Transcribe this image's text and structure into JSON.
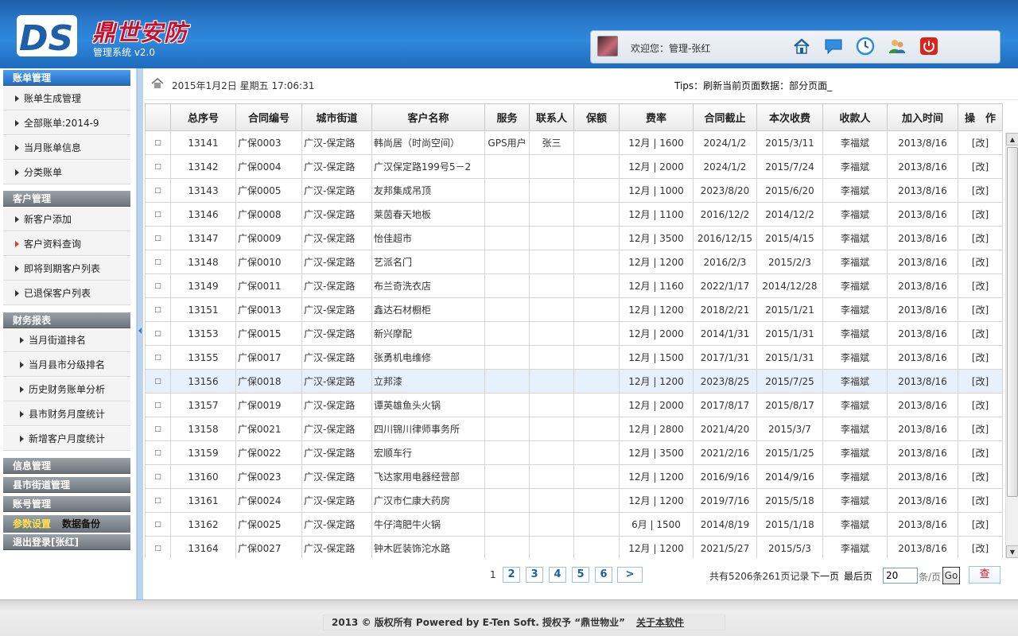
{
  "header": {
    "logo_text": "DS",
    "brand": "鼎世安防",
    "subtitle": "管理系统 v2.0",
    "welcome": "欢迎您：管理-张红",
    "icons": [
      "home-icon",
      "message-icon",
      "clock-icon",
      "users-icon",
      "power-icon"
    ]
  },
  "sidebar": {
    "groups": [
      {
        "title": "账单管理",
        "items": [
          "账单生成管理",
          "全部账单:2014-9",
          "当月账单信息",
          "分类账单"
        ]
      },
      {
        "title": "客户管理",
        "items": [
          "新客户添加",
          "客户资料查询",
          "即将到期客户列表",
          "已退保客户列表"
        ]
      },
      {
        "title": "财务报表",
        "items": [
          "当月街道排名",
          "当月县市分级排名",
          "历史财务账单分析",
          "县市财务月度统计",
          "新增客户月度统计"
        ]
      }
    ],
    "info_mgmt": "信息管理",
    "county_mgmt": "县市街道管理",
    "account_mgmt": "账号管理",
    "params": "参数设置",
    "backup": "数据备份",
    "logout": "退出登录[张红]"
  },
  "topbar": {
    "date": "2015年1月2日  星期五  17:06:31",
    "tips": "Tips：刷新当前页面数据：部分页面_"
  },
  "table": {
    "headers": [
      "",
      "总序号",
      "合同编号",
      "城市街道",
      "客户名称",
      "服务",
      "联系人",
      "保额",
      "费率",
      "合同截止",
      "本次收费",
      "收款人",
      "加入时间",
      "操　作"
    ],
    "rows": [
      [
        "□",
        "13141",
        "广保0003",
        "广汉-保定路",
        "韩尚居（时尚空间）",
        "GPS用户",
        "张三",
        "",
        "12月 | 1600",
        "2024/1/2",
        "2015/3/11",
        "李福斌",
        "2013/8/16",
        "[改]"
      ],
      [
        "□",
        "13142",
        "广保0004",
        "广汉-保定路",
        "广汉保定路199号5－2",
        "",
        "",
        "",
        "12月 | 2000",
        "2024/1/2",
        "2015/7/24",
        "李福斌",
        "2013/8/16",
        "[改]"
      ],
      [
        "□",
        "13143",
        "广保0005",
        "广汉-保定路",
        "友邦集成吊顶",
        "",
        "",
        "",
        "12月 | 1000",
        "2023/8/20",
        "2015/6/20",
        "李福斌",
        "2013/8/16",
        "[改]"
      ],
      [
        "□",
        "13146",
        "广保0008",
        "广汉-保定路",
        "莱茵春天地板",
        "",
        "",
        "",
        "12月 | 1100",
        "2016/12/2",
        "2014/12/2",
        "李福斌",
        "2013/8/16",
        "[改]"
      ],
      [
        "□",
        "13147",
        "广保0009",
        "广汉-保定路",
        "怡佳超市",
        "",
        "",
        "",
        "12月 | 3500",
        "2016/12/15",
        "2015/4/15",
        "李福斌",
        "2013/8/16",
        "[改]"
      ],
      [
        "□",
        "13148",
        "广保0010",
        "广汉-保定路",
        "艺派名门",
        "",
        "",
        "",
        "12月 | 1200",
        "2016/2/3",
        "2015/2/3",
        "李福斌",
        "2013/8/16",
        "[改]"
      ],
      [
        "□",
        "13149",
        "广保0011",
        "广汉-保定路",
        "布兰奇洗衣店",
        "",
        "",
        "",
        "12月 | 1160",
        "2022/1/17",
        "2014/12/28",
        "李福斌",
        "2013/8/16",
        "[改]"
      ],
      [
        "□",
        "13151",
        "广保0013",
        "广汉-保定路",
        "鑫达石材橱柜",
        "",
        "",
        "",
        "12月 | 1200",
        "2018/2/21",
        "2015/1/21",
        "李福斌",
        "2013/8/16",
        "[改]"
      ],
      [
        "□",
        "13153",
        "广保0015",
        "广汉-保定路",
        "新兴摩配",
        "",
        "",
        "",
        "12月 | 2000",
        "2014/1/31",
        "2015/1/31",
        "李福斌",
        "2013/8/16",
        "[改]"
      ],
      [
        "□",
        "13155",
        "广保0017",
        "广汉-保定路",
        "张勇机电维修",
        "",
        "",
        "",
        "12月 | 1500",
        "2017/1/31",
        "2015/1/31",
        "李福斌",
        "2013/8/16",
        "[改]"
      ],
      [
        "□",
        "13156",
        "广保0018",
        "广汉-保定路",
        "立邦漆",
        "",
        "",
        "",
        "12月 | 1200",
        "2023/8/25",
        "2015/7/25",
        "李福斌",
        "2013/8/16",
        "[改]"
      ],
      [
        "□",
        "13157",
        "广保0019",
        "广汉-保定路",
        "谭英雄鱼头火锅",
        "",
        "",
        "",
        "12月 | 2000",
        "2017/8/17",
        "2015/8/17",
        "李福斌",
        "2013/8/16",
        "[改]"
      ],
      [
        "□",
        "13158",
        "广保0021",
        "广汉-保定路",
        "四川锦川律师事务所",
        "",
        "",
        "",
        "12月 | 2800",
        "2021/4/20",
        "2015/3/7",
        "李福斌",
        "2013/8/16",
        "[改]"
      ],
      [
        "□",
        "13159",
        "广保0022",
        "广汉-保定路",
        "宏顺车行",
        "",
        "",
        "",
        "12月 | 3500",
        "2021/2/16",
        "2015/1/25",
        "李福斌",
        "2013/8/16",
        "[改]"
      ],
      [
        "□",
        "13160",
        "广保0023",
        "广汉-保定路",
        "飞达家用电器经营部",
        "",
        "",
        "",
        "12月 | 1200",
        "2016/9/16",
        "2014/9/16",
        "李福斌",
        "2013/8/16",
        "[改]"
      ],
      [
        "□",
        "13161",
        "广保0024",
        "广汉-保定路",
        "广汉市仁康大药房",
        "",
        "",
        "",
        "12月 | 1200",
        "2019/7/16",
        "2015/5/18",
        "李福斌",
        "2013/8/16",
        "[改]"
      ],
      [
        "□",
        "13162",
        "广保0025",
        "广汉-保定路",
        "牛仔湾肥牛火锅",
        "",
        "",
        "",
        "6月 | 1500",
        "2014/8/19",
        "2015/1/18",
        "李福斌",
        "2013/8/16",
        "[改]"
      ],
      [
        "□",
        "13164",
        "广保0027",
        "广汉-保定路",
        "钟木匠装饰沱水路",
        "",
        "",
        "",
        "12月 | 1200",
        "2021/5/27",
        "2015/5/3",
        "李福斌",
        "2013/8/16",
        "[改]"
      ]
    ],
    "highlighted_row": 10
  },
  "pager": {
    "current": "1",
    "pages": [
      "2",
      "3",
      "4",
      "5",
      "6",
      ">"
    ],
    "info": "共有5206条261页记录",
    "next": "下一页",
    "last": "最后页",
    "page_size": "20",
    "unit": "条/页",
    "go": "Go",
    "search": "查"
  },
  "footer": {
    "text": "2013 © 版权所有  Powered by E-Ten Soft.  授权予 “鼎世物业”",
    "about": "关于本软件"
  },
  "colors": {
    "header": "#2b7cd0",
    "brand": "#c8102e",
    "highlight": "#e7f1fb"
  }
}
